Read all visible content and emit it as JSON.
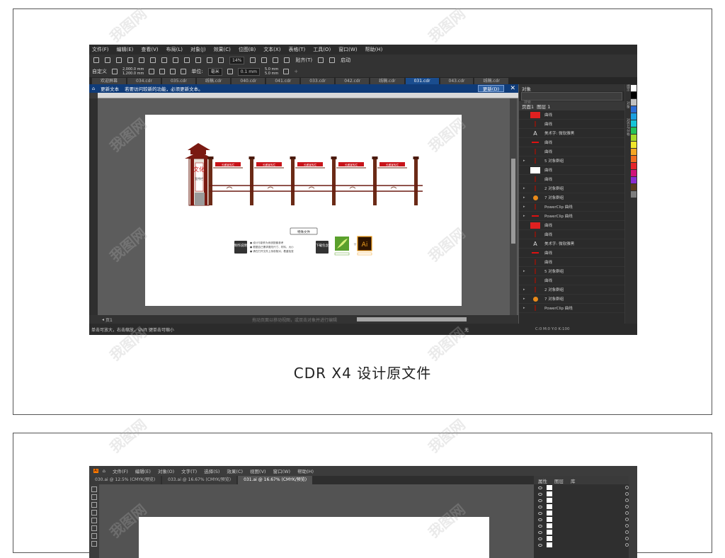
{
  "cdr": {
    "menu": [
      "文件(F)",
      "编辑(E)",
      "查看(V)",
      "布局(L)",
      "对象(J)",
      "效果(C)",
      "位图(B)",
      "文本(X)",
      "表格(T)",
      "工具(O)",
      "窗口(W)",
      "帮助(H)"
    ],
    "toolbar1": {
      "zoom": "14%",
      "snap": "贴齐(T)",
      "launch": "启动"
    },
    "toolbar2": {
      "preset": "自定义",
      "width": "2,000.0 mm",
      "height": "1,200.0 mm",
      "units_label": "单位:",
      "units": "毫米",
      "nudge": "0.1 mm",
      "dup_x": "5.0 mm",
      "dup_y": "5.0 mm"
    },
    "tabs": [
      "欢迎屏幕",
      "034.cdr",
      "035.cdr",
      "线稿.cdr",
      "040.cdr",
      "041.cdr",
      "033.cdr",
      "042.cdr",
      "线稿.cdr",
      "031.cdr",
      "043.cdr",
      "线稿.cdr"
    ],
    "active_tab": "031.cdr",
    "notice": {
      "title": "更新文本",
      "message": "若要访问较新的功能，必须更新文本。",
      "button": "更新(D)"
    },
    "page_nav": "页1",
    "hint": "拖动页面以移动视图，或双击对象并进行编辑",
    "status_left": "单击可放大，右击缩放，shift 键单击可缩小",
    "status_right": "C:0 M:0 Y:0 K:100",
    "fill_none": "无",
    "design": {
      "sign_title": "文化",
      "sign_sub": "宣传栏",
      "panel_texts": [
        "长廊宣传栏",
        "长廊宣传栏",
        "长廊宣传栏",
        "长廊宣传栏",
        "长廊宣传栏"
      ],
      "special_file": "特殊文件",
      "make_label": "制作说明",
      "make_lines": [
        "● 设计与制作为系统配套参考",
        "● 根据自己需求更改尺寸、材料、大小",
        "● 请在打开文件上传前核对，着重检查"
      ],
      "download_label": "下载包含",
      "ai_badge": "Ai"
    },
    "objects_panel": {
      "title": "对象",
      "search": "搜索",
      "page": "页面1",
      "layer": "图层 1",
      "rows": [
        {
          "name": "曲线",
          "thumb": "red-rect"
        },
        {
          "name": "曲线",
          "thumb": "dark-line"
        },
        {
          "name": "美术字: 微软雅黑",
          "thumb": "text-A"
        },
        {
          "name": "曲线",
          "thumb": "red-line"
        },
        {
          "name": "曲线",
          "thumb": "dark-line"
        },
        {
          "name": "5 对象群组",
          "thumb": "dark-line"
        },
        {
          "name": "曲线",
          "thumb": "white-rect"
        },
        {
          "name": "曲线",
          "thumb": "dark-line"
        },
        {
          "name": "2 对象群组",
          "thumb": "dark-line"
        },
        {
          "name": "7 对象群组",
          "thumb": "orange-dot"
        },
        {
          "name": "PowerClip 曲线",
          "thumb": "dark-line"
        },
        {
          "name": "PowerClip 曲线",
          "thumb": "red-line"
        },
        {
          "name": "曲线",
          "thumb": "red-rect"
        },
        {
          "name": "曲线",
          "thumb": "dark-line"
        },
        {
          "name": "美术字: 微软雅黑",
          "thumb": "text-A"
        },
        {
          "name": "曲线",
          "thumb": "red-line"
        },
        {
          "name": "曲线",
          "thumb": "dark-line"
        },
        {
          "name": "5 对象群组",
          "thumb": "dark-line"
        },
        {
          "name": "曲线",
          "thumb": "dark-line"
        },
        {
          "name": "2 对象群组",
          "thumb": "dark-line"
        },
        {
          "name": "7 对象群组",
          "thumb": "orange-dot"
        },
        {
          "name": "PowerClip 曲线",
          "thumb": "dark-line"
        }
      ]
    },
    "side_tabs": [
      "提示",
      "对象",
      "对齐与分布"
    ],
    "palette": [
      "#ffffff",
      "#000000",
      "#c0c0c0",
      "#2b6cd4",
      "#1a9fe0",
      "#15c5d8",
      "#25c25a",
      "#a5d82a",
      "#f0e52a",
      "#f5a623",
      "#f06c1f",
      "#e5262a",
      "#d1127a",
      "#8a2bd1",
      "#5b3a1f",
      "#7d7d7d"
    ]
  },
  "caption": "CDR X4 设计原文件",
  "ai": {
    "menu": [
      "文件(F)",
      "编辑(E)",
      "对象(O)",
      "文字(T)",
      "选择(S)",
      "效果(C)",
      "视图(V)",
      "窗口(W)",
      "帮助(H)"
    ],
    "tabs": [
      "030.ai @ 12.5% (CMYK/预览)",
      "033.ai @ 16.67% (CMYK/预览)",
      "031.ai @ 16.67% (CMYK/预览)"
    ],
    "panel_tabs": [
      "属性",
      "图层",
      "库"
    ]
  },
  "watermark": "我图网"
}
